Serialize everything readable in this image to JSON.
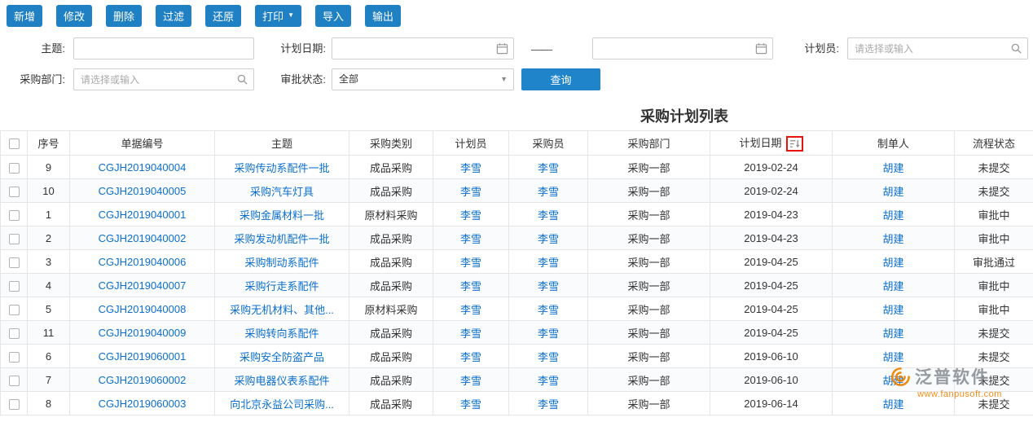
{
  "toolbar": {
    "buttons": [
      "新增",
      "修改",
      "删除",
      "过滤",
      "还原",
      "打印",
      "导入",
      "输出"
    ],
    "print_caret": "▼"
  },
  "filters": {
    "subject_label": "主题:",
    "plan_date_label": "计划日期:",
    "date_separator": "——",
    "planner_label": "计划员:",
    "planner_placeholder": "请选择或输入",
    "department_label": "采购部门:",
    "department_placeholder": "请选择或输入",
    "approval_label": "审批状态:",
    "approval_value": "全部",
    "dropdown_caret": "▼",
    "query_button": "查询"
  },
  "table": {
    "title": "采购计划列表",
    "columns": [
      {
        "key": "seq",
        "label": "序号",
        "link": false
      },
      {
        "key": "doc_no",
        "label": "单据编号",
        "link": true
      },
      {
        "key": "subject",
        "label": "主题",
        "link": true
      },
      {
        "key": "category",
        "label": "采购类别",
        "link": false
      },
      {
        "key": "planner",
        "label": "计划员",
        "link": true
      },
      {
        "key": "purchaser",
        "label": "采购员",
        "link": true
      },
      {
        "key": "department",
        "label": "采购部门",
        "link": false
      },
      {
        "key": "plan_date",
        "label": "计划日期",
        "link": false
      },
      {
        "key": "creator",
        "label": "制单人",
        "link": true
      },
      {
        "key": "status",
        "label": "流程状态",
        "link": false
      }
    ],
    "rows": [
      {
        "seq": "9",
        "doc_no": "CGJH2019040004",
        "subject": "采购传动系配件一批",
        "category": "成品采购",
        "planner": "李雪",
        "purchaser": "李雪",
        "department": "采购一部",
        "plan_date": "2019-02-24",
        "creator": "胡建",
        "status": "未提交"
      },
      {
        "seq": "10",
        "doc_no": "CGJH2019040005",
        "subject": "采购汽车灯具",
        "category": "成品采购",
        "planner": "李雪",
        "purchaser": "李雪",
        "department": "采购一部",
        "plan_date": "2019-02-24",
        "creator": "胡建",
        "status": "未提交"
      },
      {
        "seq": "1",
        "doc_no": "CGJH2019040001",
        "subject": "采购金属材料一批",
        "category": "原材料采购",
        "planner": "李雪",
        "purchaser": "李雪",
        "department": "采购一部",
        "plan_date": "2019-04-23",
        "creator": "胡建",
        "status": "审批中"
      },
      {
        "seq": "2",
        "doc_no": "CGJH2019040002",
        "subject": "采购发动机配件一批",
        "category": "成品采购",
        "planner": "李雪",
        "purchaser": "李雪",
        "department": "采购一部",
        "plan_date": "2019-04-23",
        "creator": "胡建",
        "status": "审批中"
      },
      {
        "seq": "3",
        "doc_no": "CGJH2019040006",
        "subject": "采购制动系配件",
        "category": "成品采购",
        "planner": "李雪",
        "purchaser": "李雪",
        "department": "采购一部",
        "plan_date": "2019-04-25",
        "creator": "胡建",
        "status": "审批通过"
      },
      {
        "seq": "4",
        "doc_no": "CGJH2019040007",
        "subject": "采购行走系配件",
        "category": "成品采购",
        "planner": "李雪",
        "purchaser": "李雪",
        "department": "采购一部",
        "plan_date": "2019-04-25",
        "creator": "胡建",
        "status": "审批中"
      },
      {
        "seq": "5",
        "doc_no": "CGJH2019040008",
        "subject": "采购无机材料、其他...",
        "category": "原材料采购",
        "planner": "李雪",
        "purchaser": "李雪",
        "department": "采购一部",
        "plan_date": "2019-04-25",
        "creator": "胡建",
        "status": "审批中"
      },
      {
        "seq": "11",
        "doc_no": "CGJH2019040009",
        "subject": "采购转向系配件",
        "category": "成品采购",
        "planner": "李雪",
        "purchaser": "李雪",
        "department": "采购一部",
        "plan_date": "2019-04-25",
        "creator": "胡建",
        "status": "未提交"
      },
      {
        "seq": "6",
        "doc_no": "CGJH2019060001",
        "subject": "采购安全防盗产品",
        "category": "成品采购",
        "planner": "李雪",
        "purchaser": "李雪",
        "department": "采购一部",
        "plan_date": "2019-06-10",
        "creator": "胡建",
        "status": "未提交"
      },
      {
        "seq": "7",
        "doc_no": "CGJH2019060002",
        "subject": "采购电器仪表系配件",
        "category": "成品采购",
        "planner": "李雪",
        "purchaser": "李雪",
        "department": "采购一部",
        "plan_date": "2019-06-10",
        "creator": "胡建",
        "status": "未提交"
      },
      {
        "seq": "8",
        "doc_no": "CGJH2019060003",
        "subject": "向北京永益公司采购...",
        "category": "成品采购",
        "planner": "李雪",
        "purchaser": "李雪",
        "department": "采购一部",
        "plan_date": "2019-06-14",
        "creator": "胡建",
        "status": "未提交"
      }
    ]
  },
  "watermark": {
    "brand": "泛普软件",
    "url": "www.fanpusoft.com"
  },
  "colors": {
    "accent_blue": "#1f80c4",
    "link_blue": "#0b6fce",
    "annotation_red": "#e8130c",
    "logo_orange": "#f08300"
  }
}
